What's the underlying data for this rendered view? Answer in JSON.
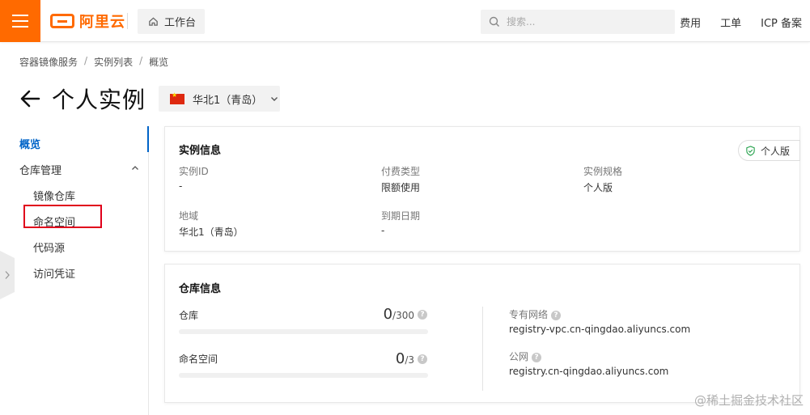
{
  "header": {
    "logo_text": "阿里云",
    "workbench_label": "工作台",
    "search_placeholder": "搜索...",
    "links": [
      "费用",
      "工单",
      "ICP 备案"
    ]
  },
  "breadcrumb": [
    "容器镜像服务",
    "实例列表",
    "概览"
  ],
  "page": {
    "title": "个人实例",
    "region": "华北1（青岛）"
  },
  "sidebar": {
    "overview": "概览",
    "group": "仓库管理",
    "items": [
      "镜像仓库",
      "命名空间",
      "代码源",
      "访问凭证"
    ]
  },
  "instance_info": {
    "title": "实例信息",
    "badge": "个人版",
    "fields": [
      {
        "label": "实例ID",
        "value": "-"
      },
      {
        "label": "付费类型",
        "value": "限额使用"
      },
      {
        "label": "实例规格",
        "value": "个人版"
      },
      {
        "label": "地域",
        "value": "华北1（青岛）"
      },
      {
        "label": "到期日期",
        "value": "-"
      }
    ]
  },
  "repo_info": {
    "title": "仓库信息",
    "quotas": [
      {
        "label": "仓库",
        "used": "0",
        "total": "/300",
        "used_fraction": 0
      },
      {
        "label": "命名空间",
        "used": "0",
        "total": "/3",
        "used_fraction": 0
      }
    ],
    "vpc_label": "专有网络",
    "vpc_value": "registry-vpc.cn-qingdao.aliyuncs.com",
    "public_label": "公网",
    "public_value": "registry.cn-qingdao.aliyuncs.com"
  },
  "watermark": "@稀土掘金技术社区",
  "colors": {
    "brand": "#ff6a00",
    "accent": "#0064c8",
    "highlight": "#e0001b"
  }
}
